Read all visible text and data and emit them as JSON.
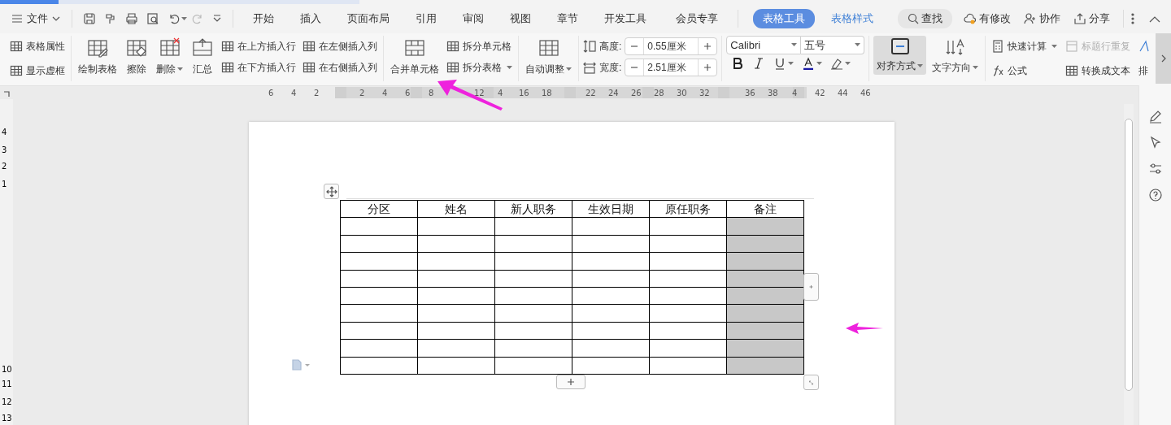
{
  "menu_bar": {
    "file_label": "文件",
    "tabs": [
      {
        "label": "开始",
        "selected": false,
        "kind": "plain"
      },
      {
        "label": "插入",
        "selected": false,
        "kind": "plain"
      },
      {
        "label": "页面布局",
        "selected": false,
        "kind": "plain"
      },
      {
        "label": "引用",
        "selected": false,
        "kind": "plain"
      },
      {
        "label": "审阅",
        "selected": false,
        "kind": "plain"
      },
      {
        "label": "视图",
        "selected": false,
        "kind": "plain"
      },
      {
        "label": "章节",
        "selected": false,
        "kind": "plain"
      },
      {
        "label": "开发工具",
        "selected": false,
        "kind": "plain"
      },
      {
        "label": "会员专享",
        "selected": false,
        "kind": "plain"
      },
      {
        "label": "表格工具",
        "selected": true,
        "kind": "context"
      },
      {
        "label": "表格样式",
        "selected": false,
        "kind": "context"
      }
    ],
    "search_label": "查找",
    "right_actions": [
      {
        "label": "有修改"
      },
      {
        "label": "协作"
      },
      {
        "label": "分享"
      }
    ]
  },
  "ribbon": {
    "props": [
      {
        "label": "表格属性"
      },
      {
        "label": "显示虚框"
      }
    ],
    "big_tools": [
      {
        "label": "绘制表格",
        "dropdown": false
      },
      {
        "label": "擦除",
        "dropdown": false
      },
      {
        "label": "删除",
        "dropdown": true
      },
      {
        "label": "汇总",
        "dropdown": false
      }
    ],
    "insert_tools": [
      {
        "label": "在上方插入行"
      },
      {
        "label": "在左侧插入列"
      },
      {
        "label": "在下方插入行"
      },
      {
        "label": "在右侧插入列"
      }
    ],
    "merge_label": "合并单元格",
    "split_tools": [
      {
        "label": "拆分单元格",
        "dropdown": false
      },
      {
        "label": "拆分表格",
        "dropdown": true
      }
    ],
    "auto_fit_label": "自动调整",
    "size_fields": [
      {
        "label": "高度:",
        "value": "0.55厘米"
      },
      {
        "label": "宽度:",
        "value": "2.51厘米"
      }
    ],
    "font": {
      "name": "Calibri",
      "size": "五号"
    },
    "align_label": "对齐方式",
    "text_direction_label": "文字方向",
    "calc_tools": [
      {
        "label": "快速计算",
        "disabled": false,
        "dropdown": true
      },
      {
        "label": "标题行重复",
        "disabled": true,
        "dropdown": false
      },
      {
        "label": "公式",
        "disabled": false,
        "dropdown": false
      },
      {
        "label": "转换成文本",
        "disabled": false,
        "dropdown": false
      }
    ],
    "cut_label": "排"
  },
  "ruler": {
    "numbers": [
      "6",
      "4",
      "2",
      "2",
      "4",
      "6",
      "8",
      "12",
      "4",
      "16",
      "18",
      "22",
      "24",
      "26",
      "28",
      "30",
      "32",
      "36",
      "38",
      "4",
      "42",
      "44",
      "46"
    ],
    "vertical_numbers": [
      "4",
      "3",
      "2",
      "1",
      "10",
      "11",
      "12",
      "13"
    ]
  },
  "table": {
    "columns": [
      {
        "label": "分区",
        "selected": false
      },
      {
        "label": "姓名",
        "selected": false
      },
      {
        "label": "新人职务",
        "selected": false
      },
      {
        "label": "生效日期",
        "selected": false
      },
      {
        "label": "原任职务",
        "selected": false
      },
      {
        "label": "备注",
        "selected": true
      }
    ],
    "rows": [
      {
        "kind": "empty"
      },
      {
        "kind": "empty"
      },
      {
        "kind": "empty"
      },
      {
        "kind": "empty"
      },
      {
        "kind": "empty"
      },
      {
        "kind": "empty"
      },
      {
        "kind": "empty"
      },
      {
        "kind": "empty"
      },
      {
        "kind": "empty"
      }
    ]
  }
}
